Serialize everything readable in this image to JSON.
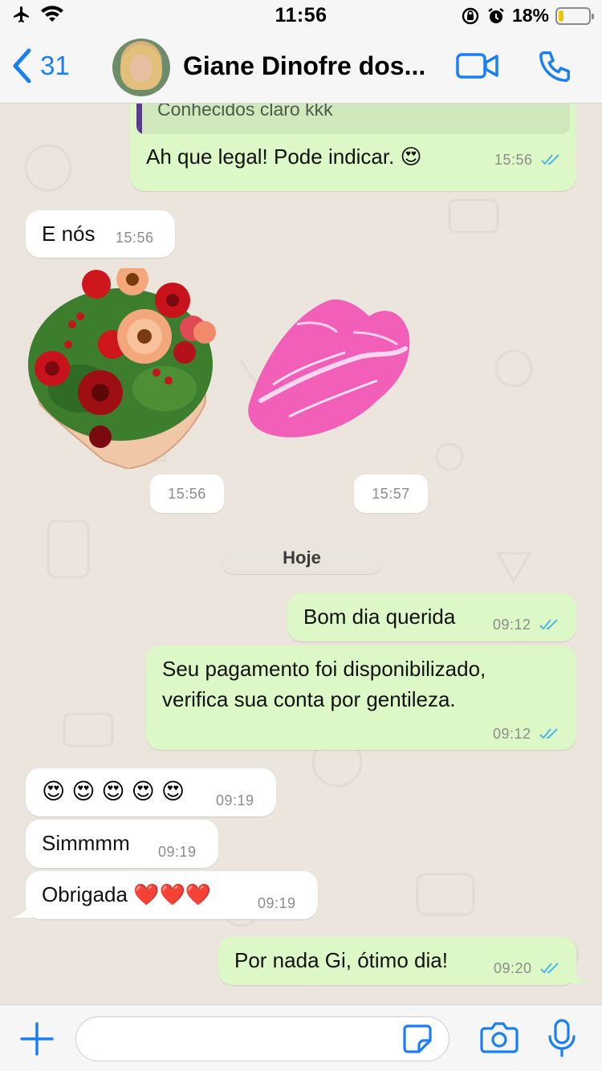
{
  "status_bar": {
    "time": "11:56",
    "battery_percent_label": "18%",
    "battery_level": 0.18,
    "icons": [
      "airplane-icon",
      "wifi-icon",
      "orientation-lock-icon",
      "alarm-icon",
      "battery-icon"
    ]
  },
  "header": {
    "back_count": "31",
    "contact_name": "Giane Dinofre dos...",
    "icons": [
      "back-chevron-icon",
      "video-call-icon",
      "phone-call-icon"
    ]
  },
  "messages": [
    {
      "direction": "out",
      "quoted": "Conhecidos claro kkk",
      "text": "Ah que legal! Pode indicar. 😍",
      "time": "15:56"
    },
    {
      "direction": "in",
      "text": "E nós",
      "time": "15:56"
    },
    {
      "direction": "in",
      "type": "sticker",
      "sticker": "flower-bouquet",
      "time": "15:56"
    },
    {
      "direction": "in",
      "type": "sticker",
      "sticker": "pink-lips-kiss",
      "time": "15:57"
    },
    {
      "direction": "out",
      "text": "Bom dia querida",
      "time": "09:12"
    },
    {
      "direction": "out",
      "text_lines": [
        "Seu pagamento foi disponibilizado,",
        "verifica sua conta por gentileza."
      ],
      "time": "09:12"
    },
    {
      "direction": "in",
      "emojis": [
        "😍",
        "😍",
        "😍",
        "😍",
        "😍"
      ],
      "time": "09:19"
    },
    {
      "direction": "in",
      "text": "Simmmm",
      "time": "09:19"
    },
    {
      "direction": "in",
      "text": "Obrigada ❤️❤️❤️",
      "time": "09:19"
    },
    {
      "direction": "out",
      "text": "Por nada Gi, ótimo dia!",
      "time": "09:20"
    }
  ],
  "date_separator": "Hoje",
  "input_bar": {
    "placeholder": "",
    "icons": [
      "plus-icon",
      "sticker-icon",
      "camera-icon",
      "microphone-icon"
    ]
  },
  "colors": {
    "accent": "#1a7ff2",
    "outgoing_bubble": "#dcf8c6",
    "incoming_bubble": "#ffffff",
    "chat_background": "#ece5dd",
    "read_ticks": "#4fb6ec",
    "battery": "#f5c400"
  }
}
